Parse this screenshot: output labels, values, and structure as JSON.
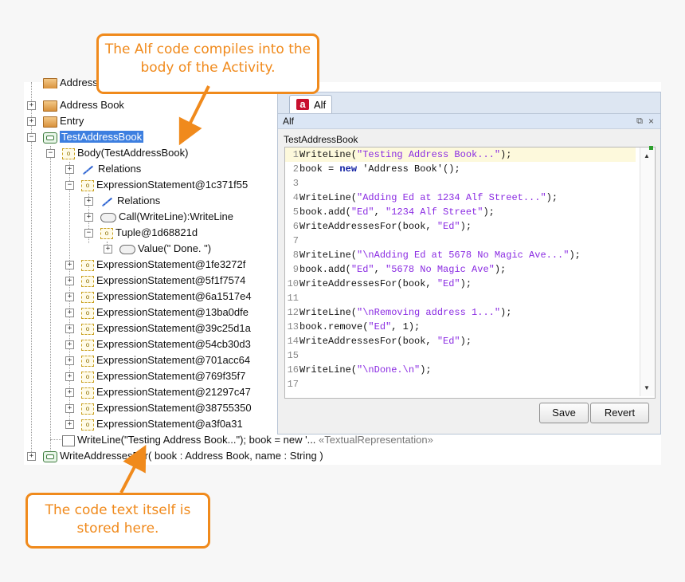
{
  "callouts": {
    "top": "The Alf code compiles into the body of the Activity.",
    "bottom": "The code text itself is stored here."
  },
  "tree": {
    "partial_top": "Address Book",
    "address_book": "Address Book",
    "entry": "Entry",
    "test_address_book": "TestAddressBook",
    "body": "Body(TestAddressBook)",
    "relations1": "Relations",
    "expr_1c371f55": "ExpressionStatement@1c371f55",
    "relations2": "Relations",
    "call": "Call(WriteLine):WriteLine",
    "tuple": "Tuple@1d68821d",
    "value": "Value(\" Done. \")",
    "statements": [
      "ExpressionStatement@1fe3272f",
      "ExpressionStatement@5f1f7574",
      "ExpressionStatement@6a1517e4",
      "ExpressionStatement@13ba0dfe",
      "ExpressionStatement@39c25d1a",
      "ExpressionStatement@54cb30d3",
      "ExpressionStatement@701acc64",
      "ExpressionStatement@769f35f7",
      "ExpressionStatement@21297c47",
      "ExpressionStatement@38755350",
      "ExpressionStatement@a3f0a31"
    ],
    "textual_rep": "WriteLine(\"Testing Address Book...\"); book = new '...",
    "textual_stereo": "«TextualRepresentation»",
    "write_addresses_for": "WriteAddressesFor( book : Address Book, name : String )"
  },
  "editor": {
    "tab_logo": "a",
    "tab_label": "Alf",
    "panel_title": "Alf",
    "restore_icon": "⧉",
    "close_icon": "×",
    "element_name": "TestAddressBook",
    "save": "Save",
    "revert": "Revert",
    "lines": [
      {
        "n": "1",
        "parts": [
          [
            "WriteLine(",
            ""
          ],
          [
            "\"Testing Address Book...\"",
            "str"
          ],
          [
            ");",
            ""
          ]
        ]
      },
      {
        "n": "2",
        "parts": [
          [
            "book = ",
            ""
          ],
          [
            "new",
            "kw"
          ],
          [
            " 'Address Book'();",
            ""
          ]
        ]
      },
      {
        "n": "3",
        "parts": []
      },
      {
        "n": "4",
        "parts": [
          [
            "WriteLine(",
            ""
          ],
          [
            "\"Adding Ed at 1234 Alf Street...\"",
            "str"
          ],
          [
            ");",
            ""
          ]
        ]
      },
      {
        "n": "5",
        "parts": [
          [
            "book.add(",
            ""
          ],
          [
            "\"Ed\"",
            "str"
          ],
          [
            ", ",
            ""
          ],
          [
            "\"1234 Alf Street\"",
            "str"
          ],
          [
            ");",
            ""
          ]
        ]
      },
      {
        "n": "6",
        "parts": [
          [
            "WriteAddressesFor(book, ",
            ""
          ],
          [
            "\"Ed\"",
            "str"
          ],
          [
            ");",
            ""
          ]
        ]
      },
      {
        "n": "7",
        "parts": []
      },
      {
        "n": "8",
        "parts": [
          [
            "WriteLine(",
            ""
          ],
          [
            "\"\\nAdding Ed at 5678 No Magic Ave...\"",
            "str"
          ],
          [
            ");",
            ""
          ]
        ]
      },
      {
        "n": "9",
        "parts": [
          [
            "book.add(",
            ""
          ],
          [
            "\"Ed\"",
            "str"
          ],
          [
            ", ",
            ""
          ],
          [
            "\"5678 No Magic Ave\"",
            "str"
          ],
          [
            ");",
            ""
          ]
        ]
      },
      {
        "n": "10",
        "parts": [
          [
            "WriteAddressesFor(book, ",
            ""
          ],
          [
            "\"Ed\"",
            "str"
          ],
          [
            ");",
            ""
          ]
        ]
      },
      {
        "n": "11",
        "parts": []
      },
      {
        "n": "12",
        "parts": [
          [
            "WriteLine(",
            ""
          ],
          [
            "\"\\nRemoving address 1...\"",
            "str"
          ],
          [
            ");",
            ""
          ]
        ]
      },
      {
        "n": "13",
        "parts": [
          [
            "book.remove(",
            ""
          ],
          [
            "\"Ed\"",
            "str"
          ],
          [
            ", 1);",
            ""
          ]
        ]
      },
      {
        "n": "14",
        "parts": [
          [
            "WriteAddressesFor(book, ",
            ""
          ],
          [
            "\"Ed\"",
            "str"
          ],
          [
            ");",
            ""
          ]
        ]
      },
      {
        "n": "15",
        "parts": []
      },
      {
        "n": "16",
        "parts": [
          [
            "WriteLine(",
            ""
          ],
          [
            "\"\\nDone.\\n\"",
            "str"
          ],
          [
            ");",
            ""
          ]
        ]
      },
      {
        "n": "17",
        "parts": []
      }
    ]
  },
  "colors": {
    "callout": "#f08a1c",
    "selection": "#3d7fe0",
    "string": "#8a2be2",
    "keyword": "#0a1aa0"
  }
}
